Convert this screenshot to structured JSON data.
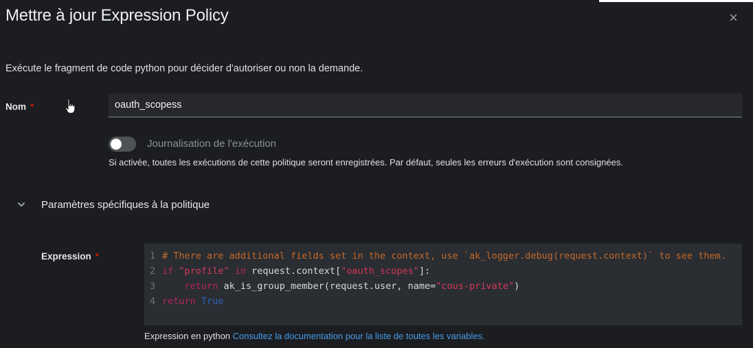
{
  "modal": {
    "title": "Mettre à jour Expression Policy",
    "close_glyph": "×",
    "description": "Exécute le fragment de code python pour décider d'autoriser ou non la demande."
  },
  "name_field": {
    "label": "Nom",
    "required_marker": "*",
    "value": "oauth_scopess"
  },
  "execution_logging": {
    "label": "Journalisation de l'exécution",
    "enabled": false,
    "helper": "Si activée, toutes les exécutions de cette politique seront enregistrées. Par défaut, seules les erreurs d'exécution sont consignées."
  },
  "section": {
    "title": "Paramètres spécifiques à la politique",
    "expanded": true
  },
  "expression_field": {
    "label": "Expression",
    "required_marker": "*",
    "line_numbers": [
      "1",
      "2",
      "3",
      "4"
    ],
    "code": {
      "l1_comment": "# There are additional fields set in the context, use `ak_logger.debug(request.context)` to see them.",
      "l2_if": "if",
      "l2_profile": "\"profile\"",
      "l2_in": "in",
      "l2_rest1": "request.context[",
      "l2_scopes": "\"oauth_scopes\"",
      "l2_rest2": "]:",
      "l3_indent": "    ",
      "l3_return": "return",
      "l3_call": "ak_is_group_member(request.user, name=",
      "l3_arg": "\"cous-private\"",
      "l3_close": ")",
      "l4_return": "return",
      "l4_true": "True"
    },
    "helper_text": "Expression en python",
    "helper_link": "Consultez la documentation pour la liste de toutes les variables."
  },
  "colors": {
    "background": "#1b1d21",
    "input_bg": "#26282c",
    "code_bg": "#2a2d32",
    "required": "#c9190b",
    "link": "#4a9eed",
    "comment": "#c56a2a",
    "keyword": "#b7255e",
    "string": "#d63a5b"
  },
  "icons": {
    "close": "close-icon",
    "chevron": "chevron-down-icon",
    "cursor": "hand-pointer-icon"
  }
}
